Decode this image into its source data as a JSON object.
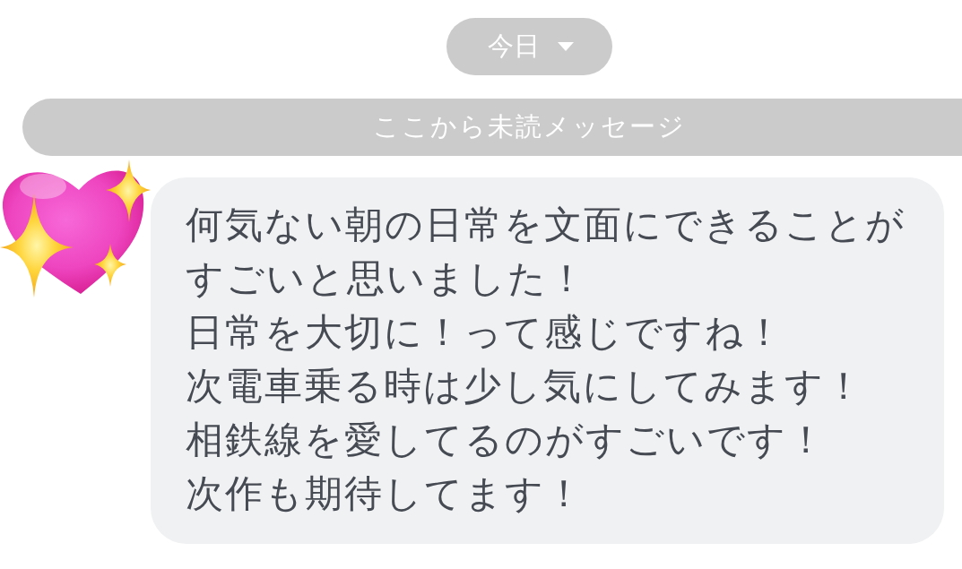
{
  "date_chip": {
    "label": "今日"
  },
  "unread_divider": {
    "label": "ここから未読メッセージ"
  },
  "message": {
    "lines": [
      "何気ない朝の日常を文面にできることがすごいと思いました！",
      "日常を大切に！って感じですね！",
      "次電車乗る時は少し気にしてみます！",
      "相鉄線を愛してるのがすごいです！",
      "次作も期待してます！"
    ]
  }
}
